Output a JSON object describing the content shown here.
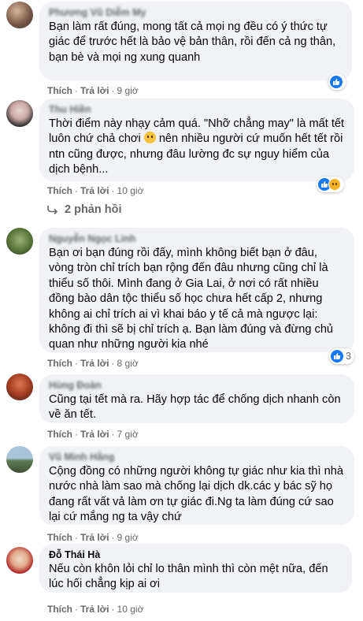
{
  "colors": {
    "like": "#1877f2",
    "sad": "#f7b125",
    "bubble": "#f0f2f5",
    "meta": "#65676b"
  },
  "labels": {
    "like": "Thích",
    "reply": "Trả lời",
    "separator": "·"
  },
  "comments": [
    {
      "name": "Phương Vũ Diễm My",
      "text": "Bạn làm rất đúng, mong tất cả mọi ng đều có ý thức tự giác để trước hết là bảo vệ bản thân, rồi đến cả ng thân, bạn bè và mọi ng xung quanh",
      "time": "9 giờ",
      "reactions": {
        "icons": [
          "like-icon"
        ],
        "count": ""
      }
    },
    {
      "name": "Thu Hiền",
      "text_before": "Thời điểm này nhạy cảm quá. \"Nhỡ chẳng may\" là mất tết luôn chứ chả chơi",
      "text_after": " nên nhiều người cứ muốn hết tết rồi ntn cũng được, nhưng đâu lường đc sự nguy hiểm của dịch bệnh...",
      "emoji": "sad-face",
      "time": "10 giờ",
      "reactions": {
        "icons": [
          "like-icon",
          "sad-icon"
        ],
        "count": ""
      },
      "replies": "2 phản hồi"
    },
    {
      "name": "Nguyễn Ngọc Linh",
      "text": "Bạn ơi bạn đúng rồi đấy, mình không biết bạn ở đâu, vòng tròn chỉ trích bạn rộng đến đâu nhưng cũng chỉ là thiểu số thôi. Mình đang ở Gia Lai, ở nơi có rất nhiều đồng bào dân tộc thiểu số học chưa hết cấp 2, nhưng không ai chỉ trích ai vì khai báo y tế cả mà ngược lại: không đi thì sẽ bị chỉ trích ạ. Bạn làm đúng và đừng chủ quan như những người kia nhé",
      "time": "8 giờ",
      "reactions": {
        "icons": [
          "like-icon"
        ],
        "count": "3"
      }
    },
    {
      "name": "Hùng Đoàn",
      "text": "Cũng tại tết mà ra. Hãy hợp tác để chống dịch nhanh còn về ăn tết.",
      "time": "7 giờ",
      "reactions": null
    },
    {
      "name": "Vũ Minh Hằng",
      "text": "Cộng đồng có những người không tự giác như kia thì nhà nước nhà làm sao mà chống lại dịch dk.các y bác sỹ họ đang rất vất vả làm ơn tự giác đi.Ng ta làm đúng cứ sao lại cứ mắng ng ta vậy chứ",
      "time": "9 giờ",
      "reactions": null
    },
    {
      "name": "Đỗ Thái Hà",
      "text": "Nếu còn khôn lỏi chỉ lo thân mình thì còn mệt nữa, đến lúc hối chẳng kịp ai ơi",
      "time": "10 giờ",
      "reactions": null
    }
  ]
}
